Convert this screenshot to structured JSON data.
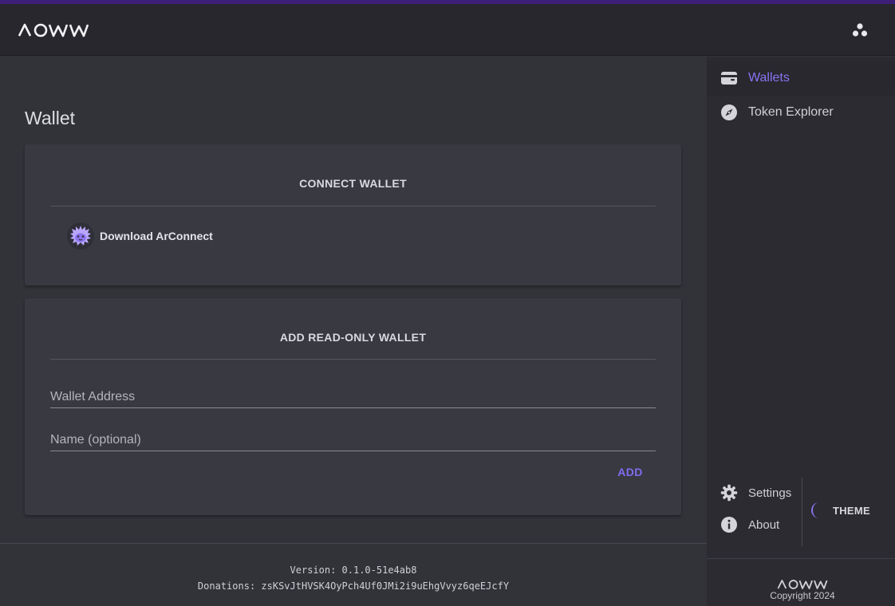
{
  "app": {
    "logo_text": "AOWW",
    "accent": "#7f6cf0",
    "header_bg": "#27272d",
    "stripe": "#3d1f78"
  },
  "header": {
    "apps_icon": "apps-icon"
  },
  "main": {
    "title": "Wallet",
    "connect_card": {
      "title": "CONNECT WALLET",
      "arconnect_label": "Download ArConnect",
      "arconnect_icon": "arconnect-hedgehog-icon"
    },
    "readonly_card": {
      "title": "ADD READ-ONLY WALLET",
      "address_placeholder": "Wallet Address",
      "address_value": "",
      "name_placeholder": "Name (optional)",
      "name_value": "",
      "add_label": "ADD"
    }
  },
  "footer": {
    "version": "Version: 0.1.0-51e4ab8",
    "donations": "Donations: zsKSvJtHVSK4OyPch4Uf0JMi2i9uEhgVvyz6qeEJcfY"
  },
  "sidebar": {
    "items": [
      {
        "label": "Wallets",
        "icon": "wallet-icon",
        "active": true
      },
      {
        "label": "Token Explorer",
        "icon": "compass-icon",
        "active": false
      }
    ],
    "settings_label": "Settings",
    "about_label": "About",
    "theme_label": "THEME",
    "theme_icon": "moon-icon",
    "copyright": "Copyright 2024"
  }
}
